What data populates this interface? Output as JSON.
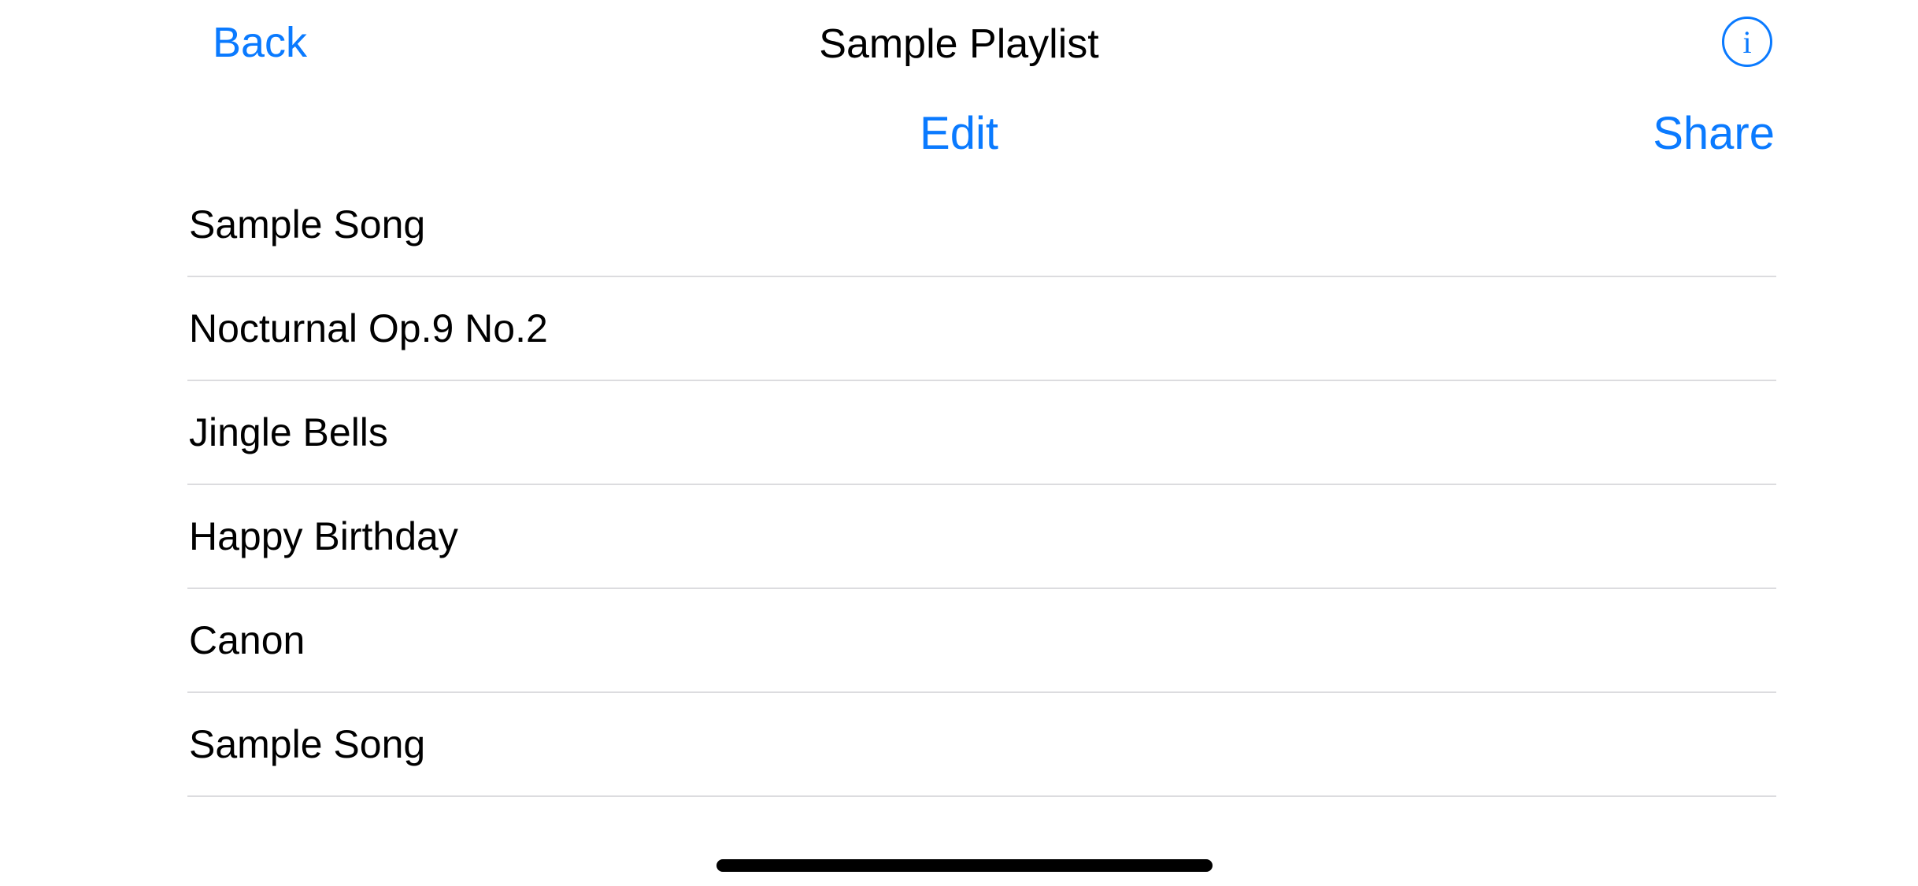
{
  "nav": {
    "back_label": "Back",
    "title": "Sample Playlist",
    "info_icon": "info-circle-icon"
  },
  "toolbar": {
    "edit_label": "Edit",
    "share_label": "Share"
  },
  "songs": [
    {
      "title": "Sample Song"
    },
    {
      "title": "Nocturnal Op.9 No.2"
    },
    {
      "title": "Jingle Bells"
    },
    {
      "title": "Happy Birthday"
    },
    {
      "title": "Canon"
    },
    {
      "title": "Sample Song"
    }
  ],
  "colors": {
    "accent": "#0a7aff",
    "separator": "#dcdcdf",
    "background": "#ffffff",
    "text": "#000000"
  }
}
